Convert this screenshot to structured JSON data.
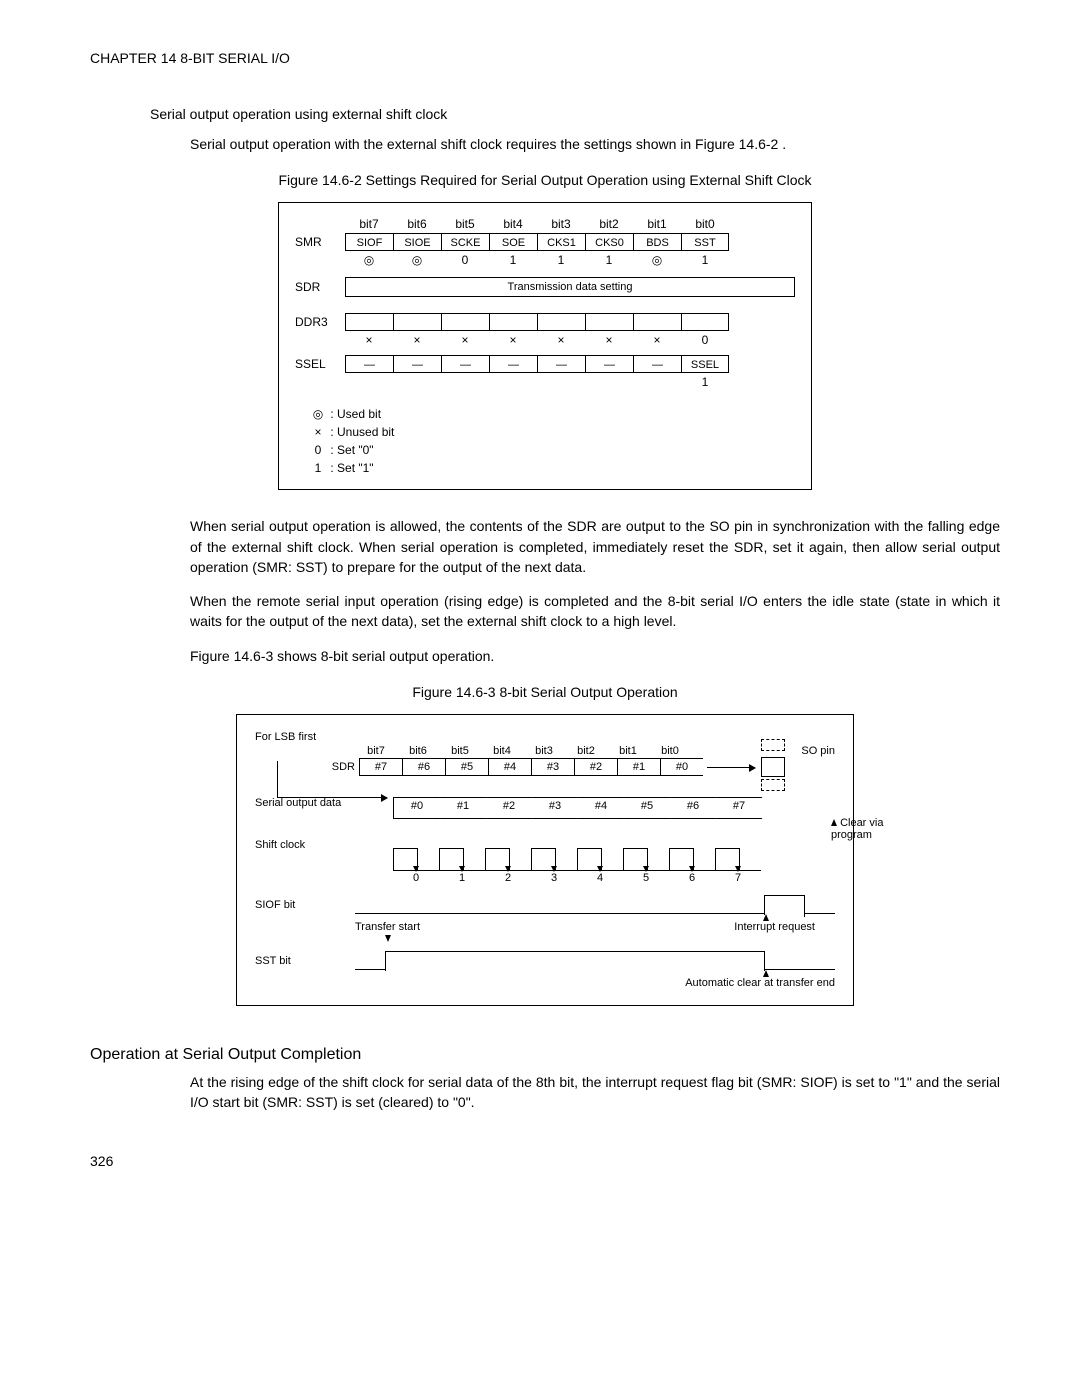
{
  "chapter_header": "CHAPTER 14  8-BIT SERIAL I/O",
  "sec1_title": "Serial output operation using external shift clock",
  "sec1_body": "Serial output operation with the external shift clock requires the settings shown in Figure 14.6-2 .",
  "fig1_cap": "Figure 14.6-2  Settings Required for Serial Output Operation using External Shift Clock",
  "reg": {
    "bit_headers": [
      "bit7",
      "bit6",
      "bit5",
      "bit4",
      "bit3",
      "bit2",
      "bit1",
      "bit0"
    ],
    "smr_label": "SMR",
    "smr_bits": [
      "SIOF",
      "SIOE",
      "SCKE",
      "SOE",
      "CKS1",
      "CKS0",
      "BDS",
      "SST"
    ],
    "smr_vals": [
      "◎",
      "◎",
      "0",
      "1",
      "1",
      "1",
      "◎",
      "1"
    ],
    "sdr_label": "SDR",
    "sdr_text": "Transmission data setting",
    "ddr_label": "DDR3",
    "ddr_vals": [
      "×",
      "×",
      "×",
      "×",
      "×",
      "×",
      "×",
      "0"
    ],
    "ssel_label": "SSEL",
    "ssel_bits": [
      "—",
      "—",
      "—",
      "—",
      "—",
      "—",
      "—",
      "SSEL"
    ],
    "ssel_vals": [
      "",
      "",
      "",
      "",
      "",
      "",
      "",
      "1"
    ]
  },
  "legend": {
    "l1s": "◎",
    "l1t": ": Used bit",
    "l2s": "×",
    "l2t": ": Unused bit",
    "l3s": "0",
    "l3t": ": Set \"0\"",
    "l4s": "1",
    "l4t": ": Set \"1\""
  },
  "p1": "When serial output operation is allowed, the contents of the SDR are output to the SO pin in synchronization with the falling edge of the external shift clock. When serial operation is completed, immediately reset the SDR, set it again, then allow serial output operation (SMR: SST) to prepare for the output of the next data.",
  "p2": "When the remote serial input operation (rising edge) is completed and the 8-bit serial I/O enters the idle state (state in which it waits for the output of the next data), set the external shift clock to a high level.",
  "p3": "Figure 14.6-3 shows 8-bit serial output operation.",
  "fig2_cap": "Figure 14.6-3  8-bit Serial Output Operation",
  "timing": {
    "for_lsb": "For LSB first",
    "bit_headers": [
      "bit7",
      "bit6",
      "bit5",
      "bit4",
      "bit3",
      "bit2",
      "bit1",
      "bit0"
    ],
    "sdr_label": "SDR",
    "sdr_vals": [
      "#7",
      "#6",
      "#5",
      "#4",
      "#3",
      "#2",
      "#1",
      "#0"
    ],
    "so_pin": "SO pin",
    "serial_out": "Serial output data",
    "hex_vals": [
      "#0",
      "#1",
      "#2",
      "#3",
      "#4",
      "#5",
      "#6",
      "#7"
    ],
    "shift_clock": "Shift clock",
    "clk_nums": [
      "0",
      "1",
      "2",
      "3",
      "4",
      "5",
      "6",
      "7"
    ],
    "clear_prog": "Clear via program",
    "siof": "SIOF bit",
    "transfer_start": "Transfer start",
    "interrupt": "Interrupt request",
    "sst": "SST bit",
    "auto_clear": "Automatic clear at transfer end"
  },
  "h2": "Operation at Serial Output Completion",
  "p4": "At the rising edge of the shift clock for serial data of the 8th bit, the interrupt request flag bit (SMR: SIOF) is set to \"1\" and the serial I/O start bit (SMR: SST) is set (cleared) to \"0\".",
  "page_num": "326",
  "chart_data": {
    "type": "table",
    "title": "Figure 14.6-2 Settings Required for Serial Output Operation using External Shift Clock",
    "columns": [
      "bit7",
      "bit6",
      "bit5",
      "bit4",
      "bit3",
      "bit2",
      "bit1",
      "bit0"
    ],
    "rows": [
      {
        "name": "SMR bit names",
        "values": [
          "SIOF",
          "SIOE",
          "SCKE",
          "SOE",
          "CKS1",
          "CKS0",
          "BDS",
          "SST"
        ]
      },
      {
        "name": "SMR settings",
        "values": [
          "used",
          "used",
          "0",
          "1",
          "1",
          "1",
          "used",
          "1"
        ]
      },
      {
        "name": "SDR",
        "values": [
          "Transmission data setting"
        ]
      },
      {
        "name": "DDR3",
        "values": [
          "×",
          "×",
          "×",
          "×",
          "×",
          "×",
          "×",
          "0"
        ]
      },
      {
        "name": "SSEL bit names",
        "values": [
          "—",
          "—",
          "—",
          "—",
          "—",
          "—",
          "—",
          "SSEL"
        ]
      },
      {
        "name": "SSEL settings",
        "values": [
          "",
          "",
          "",
          "",
          "",
          "",
          "",
          "1"
        ]
      }
    ],
    "legend": {
      "◎": "Used bit",
      "×": "Unused bit",
      "0": "Set \"0\"",
      "1": "Set \"1\""
    }
  }
}
